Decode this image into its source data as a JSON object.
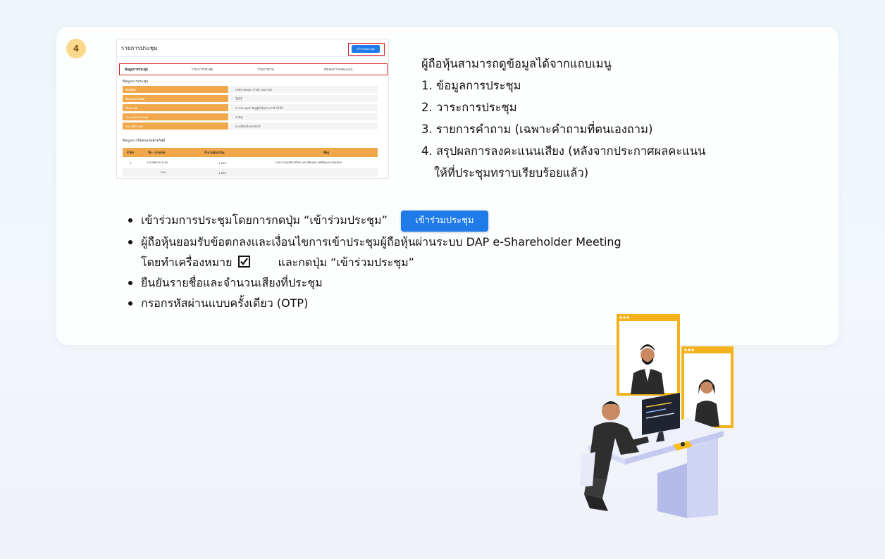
{
  "step": {
    "number": "4"
  },
  "mini_screen": {
    "title": "รายการประชุม",
    "join_button": "เข้าร่วมประชุม",
    "tabs": [
      "ข้อมูลการประชุม",
      "วาระการประชุม",
      "รายการถาม",
      "สรุปผลการลงคะแนน"
    ],
    "section1": "ข้อมูลการประชุม",
    "rows": [
      {
        "k": "ชื่อบริษัท",
        "v": "บริษัท ทดสอบ จำกัด (มหาชน)"
      },
      {
        "k": "ชื่อย่อหลักทรัพย์",
        "v": "TEST"
      },
      {
        "k": "ชื่อประชุม",
        "v": "การประชุมสามัญผู้ถือหุ้นประจำปี 2565"
      },
      {
        "k": "ประเภทการประชุม",
        "v": "สามัญ"
      },
      {
        "k": "สถานที่ประชุม",
        "v": "ผ่านสื่ออิเล็กทรอนิกส์"
      }
    ],
    "section2": "ข้อมูลการถือครองหลักทรัพย์",
    "table_headers": [
      "ลำดับ",
      "ชื่อ - นามสกุล",
      "จำนวนหุ้นสามัญ",
      "ที่อยู่"
    ],
    "table_rows": [
      [
        "1",
        "นาย ทดสอบ ระบบ",
        "1,000",
        "140/7 ถนนรัชดาภิเษก แขวงดินแดง เขตดินแดง กรุงเทพฯ"
      ],
      [
        "",
        "รวม",
        "1,000",
        ""
      ]
    ]
  },
  "description": {
    "lead": "ผู้ถือหุ้นสามารถดูข้อมูลได้จากแถบเมนู",
    "items": [
      "1. ข้อมูลการประชุม",
      "2. วาระการประชุม",
      "3. รายการคำถาม (เฉพาะคำถามที่ตนเองถาม)",
      "4. สรุปผลการลงคะแนนเสียง (หลังจากประกาศผลคะแนน"
    ],
    "item4_cont": "ให้ที่ประชุมทราบเรียบร้อยแล้ว)"
  },
  "bullets": {
    "b1": "เข้าร่วมการประชุมโดยการกดปุ่ม “เข้าร่วมประชุม”",
    "join_button": "เข้าร่วมประชุม",
    "b2": "ผู้ถือหุ้นยอมรับข้อตกลงและเงื่อนไขการเข้าประชุมผู้ถือหุ้นผ่านระบบ DAP e-Shareholder Meeting",
    "b2_cont_a": "โดยทำเครื่องหมาย",
    "b2_cont_b": "และกดปุ่ม “เข้าร่วมประชุม”",
    "b3": "ยืนยันรายชื่อและจำนวนเสียงที่ประชุม",
    "b4": "กรอกรหัสผ่านแบบครั้งเดียว (OTP)"
  },
  "icons": {
    "checkbox": "checked-box-icon",
    "illustration": "online-meeting-illustration-icon"
  },
  "colors": {
    "accent_blue": "#1e7be8",
    "orange": "#f1a84a",
    "badge": "#fbd88c",
    "highlight_red": "#d92020"
  }
}
